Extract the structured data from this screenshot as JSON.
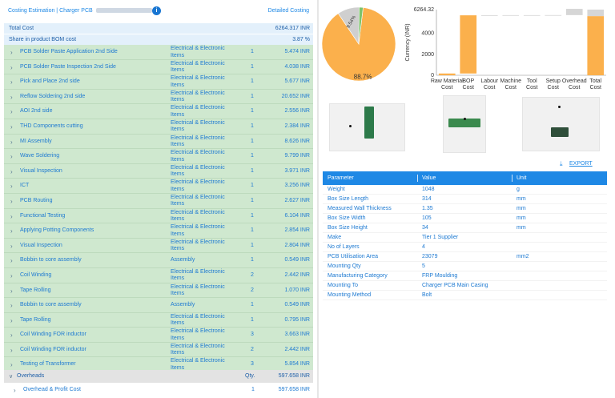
{
  "header": {
    "breadcrumb": "Costing Estimation | Charger PCB",
    "info_icon": "info-icon",
    "detailed_link": "Detailed Costing"
  },
  "summary": {
    "total_cost_label": "Total Cost",
    "total_cost_value": "6264.317 INR",
    "share_label": "Share in product BOM cost",
    "share_value": "3.87 %"
  },
  "rows": [
    {
      "name": "PCB Solder Paste Application 2nd Side",
      "category": "Electrical & Electronic Items",
      "qty": "1",
      "cost": "5.474 INR"
    },
    {
      "name": "PCB Solder Paste Inspection 2nd Side",
      "category": "Electrical & Electronic Items",
      "qty": "1",
      "cost": "4.038 INR"
    },
    {
      "name": "Pick and Place 2nd side",
      "category": "Electrical & Electronic Items",
      "qty": "1",
      "cost": "5.677 INR"
    },
    {
      "name": "Reflow Soldering 2nd side",
      "category": "Electrical & Electronic Items",
      "qty": "1",
      "cost": "20.652 INR"
    },
    {
      "name": "AOI 2nd side",
      "category": "Electrical & Electronic Items",
      "qty": "1",
      "cost": "2.556 INR"
    },
    {
      "name": "THD Components cutting",
      "category": "Electrical & Electronic Items",
      "qty": "1",
      "cost": "2.384 INR"
    },
    {
      "name": "MI Assembly",
      "category": "Electrical & Electronic Items",
      "qty": "1",
      "cost": "8.626 INR"
    },
    {
      "name": "Wave Soldering",
      "category": "Electrical & Electronic Items",
      "qty": "1",
      "cost": "9.799 INR"
    },
    {
      "name": "Visual Inspection",
      "category": "Electrical & Electronic Items",
      "qty": "1",
      "cost": "3.971 INR"
    },
    {
      "name": "ICT",
      "category": "Electrical & Electronic Items",
      "qty": "1",
      "cost": "3.256 INR"
    },
    {
      "name": "PCB Routing",
      "category": "Electrical & Electronic Items",
      "qty": "1",
      "cost": "2.627 INR"
    },
    {
      "name": "Functional Testing",
      "category": "Electrical & Electronic Items",
      "qty": "1",
      "cost": "6.104 INR"
    },
    {
      "name": "Applying Potting Components",
      "category": "Electrical & Electronic Items",
      "qty": "1",
      "cost": "2.854 INR"
    },
    {
      "name": "Visual Inspection",
      "category": "Electrical & Electronic Items",
      "qty": "1",
      "cost": "2.804 INR"
    },
    {
      "name": "Bobbin to core assembly",
      "category": "Assembly",
      "qty": "1",
      "cost": "0.549 INR"
    },
    {
      "name": "Coil Winding",
      "category": "Electrical & Electronic Items",
      "qty": "2",
      "cost": "2.442 INR"
    },
    {
      "name": "Tape Rolling",
      "category": "Electrical & Electronic Items",
      "qty": "2",
      "cost": "1.070 INR"
    },
    {
      "name": "Bobbin to core assembly",
      "category": "Assembly",
      "qty": "1",
      "cost": "0.549 INR"
    },
    {
      "name": "Tape Rolling",
      "category": "Electrical & Electronic Items",
      "qty": "1",
      "cost": "0.795 INR"
    },
    {
      "name": "Coil Winding FOR inductor",
      "category": "Electrical & Electronic Items",
      "qty": "3",
      "cost": "3.663 INR"
    },
    {
      "name": "Coil Winding FOR inductor",
      "category": "Electrical & Electronic Items",
      "qty": "2",
      "cost": "2.442 INR"
    },
    {
      "name": "Testing of Transformer",
      "category": "Electrical & Electronic Items",
      "qty": "3",
      "cost": "5.854 INR"
    }
  ],
  "overheads": {
    "label": "Overheads",
    "qty_header": "Qty.",
    "cost": "597.658 INR",
    "row_name": "Overhead & Profit Cost",
    "row_qty": "1",
    "row_cost": "597.658 INR"
  },
  "export_label": "EXPORT",
  "param_table": {
    "headers": [
      "Parameter",
      "Value",
      "Unit"
    ],
    "rows": [
      [
        "Weight",
        "1048",
        "g"
      ],
      [
        "Box Size Length",
        "314",
        "mm"
      ],
      [
        "Measured Wall Thickness",
        "1.35",
        "mm"
      ],
      [
        "Box Size Width",
        "105",
        "mm"
      ],
      [
        "Box Size Height",
        "34",
        "mm"
      ],
      [
        "Make",
        "Tier 1 Supplier",
        ""
      ],
      [
        "No of Layers",
        "4",
        ""
      ],
      [
        "PCB Utilisation Area",
        "23079",
        "mm2"
      ],
      [
        "Mounting Qty",
        "5",
        ""
      ],
      [
        "Manufacturing Category",
        "FRP Moulding",
        ""
      ],
      [
        "Mounting To",
        "Charger PCB Main Casing",
        ""
      ],
      [
        "Mounting Method",
        "Bolt",
        ""
      ]
    ]
  },
  "chart_data": [
    {
      "type": "pie",
      "slices": [
        {
          "label": "88.7%",
          "value": 88.7,
          "color": "#fbb04c"
        },
        {
          "label": "9.54%",
          "value": 9.54,
          "color": "#cfcfcf"
        },
        {
          "label": "",
          "value": 1.76,
          "color": "#7cc36b"
        }
      ]
    },
    {
      "type": "bar",
      "ylabel": "Currency (INR)",
      "ylim": [
        0,
        6264.32
      ],
      "top_tick_label": "6264.32",
      "y_ticks": [
        0,
        2000,
        4000
      ],
      "categories": [
        "Raw Material Cost",
        "BOP Cost",
        "Labour Cost",
        "Machine Cost",
        "Tool Cost",
        "Setup Cost",
        "Overhead Cost",
        "Total Cost"
      ],
      "category_lines": [
        [
          "Raw Material",
          "Cost"
        ],
        [
          "BOP",
          "Cost"
        ],
        [
          "Labour",
          "Cost"
        ],
        [
          "Machine",
          "Cost"
        ],
        [
          "Tool",
          "Cost"
        ],
        [
          "Setup",
          "Cost"
        ],
        [
          "Overhead",
          "Cost"
        ],
        [
          "Total",
          "Cost"
        ]
      ],
      "base": [
        0,
        170,
        5720,
        5730,
        5735,
        5735,
        5740,
        0
      ],
      "values": [
        170,
        5550,
        10,
        5,
        0,
        5,
        597.658,
        5640
      ],
      "total_overlay": 6264.32,
      "colors": {
        "bar": "#fbb04c",
        "overlay": "#d6d6d6"
      }
    }
  ],
  "colors": {
    "accent": "#1e88e5",
    "row_green": "#cfe8cf",
    "summary_blue": "#e3f0fb"
  }
}
